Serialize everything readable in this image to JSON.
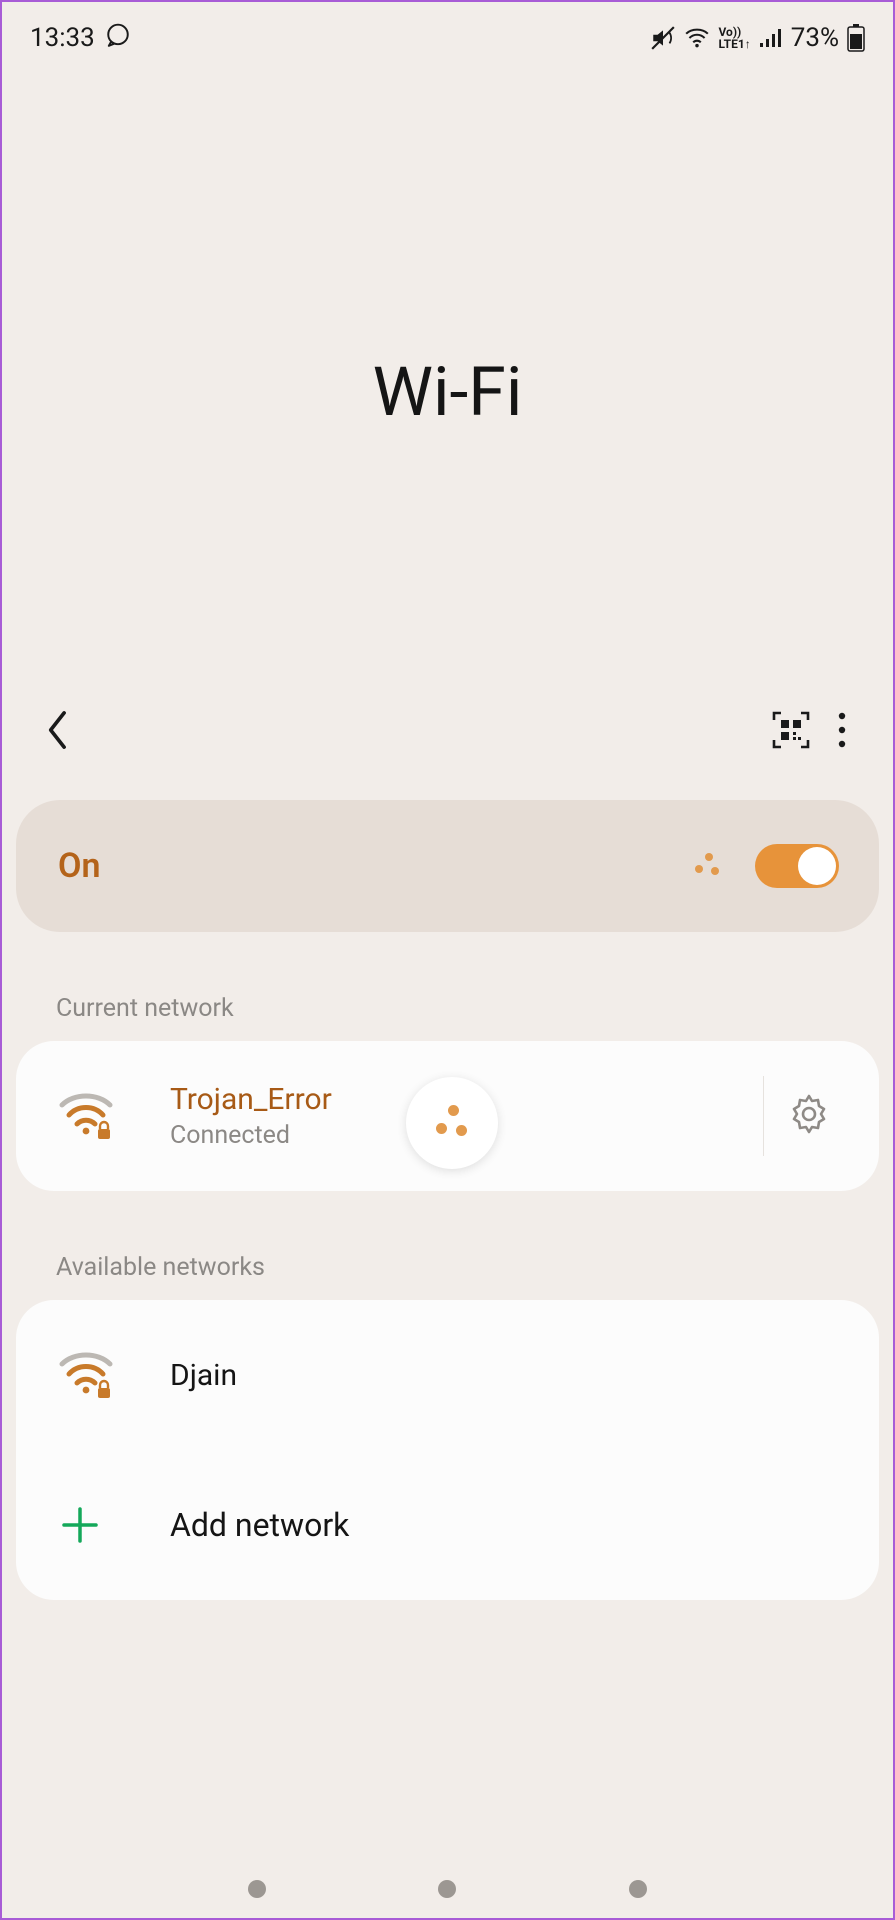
{
  "status": {
    "time": "13:33",
    "battery": "73%"
  },
  "page": {
    "title": "Wi-Fi"
  },
  "toggle": {
    "label": "On",
    "state": true
  },
  "sections": {
    "current_header": "Current network",
    "available_header": "Available networks"
  },
  "current_network": {
    "ssid": "Trojan_Error",
    "status": "Connected"
  },
  "available_networks": [
    {
      "ssid": "Djain"
    }
  ],
  "actions": {
    "add_network": "Add network"
  },
  "colors": {
    "accent": "#e7933a",
    "accent_text": "#b4631a",
    "bg": "#f2ede9"
  }
}
